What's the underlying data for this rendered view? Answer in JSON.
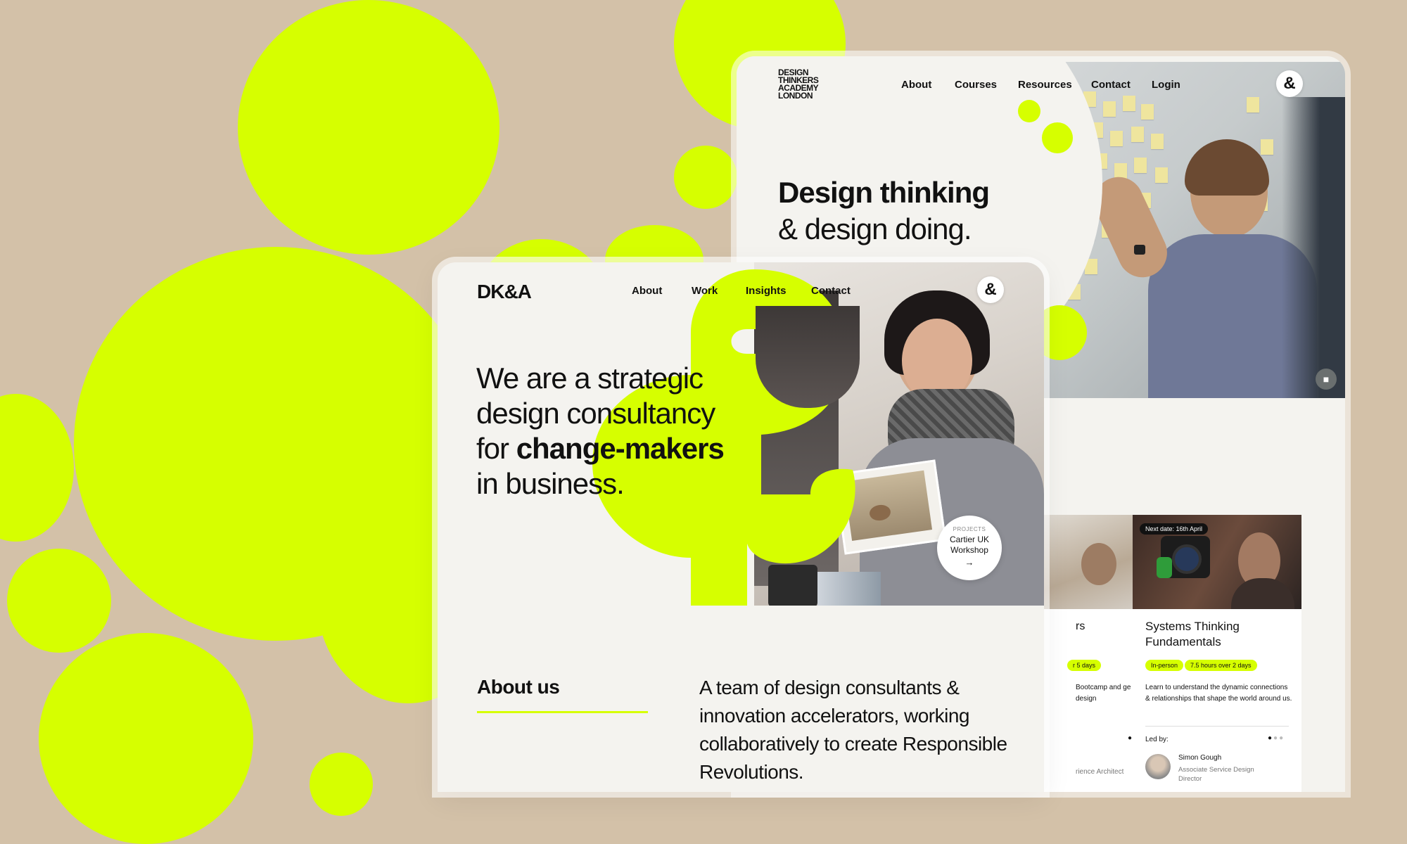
{
  "back_site": {
    "logo": "DESIGN THINKERS ACADEMY LONDON",
    "logo_lines": [
      "DESIGN",
      "THINKERS",
      "ACADEMY",
      "LONDON"
    ],
    "nav": [
      "About",
      "Courses",
      "Resources",
      "Contact",
      "Login"
    ],
    "logo_icon": "ampersand-icon",
    "hero_title_bold": "Design thinking",
    "hero_title_rest": "& design doing.",
    "chat_icon": "chat-icon",
    "course_cards": [
      {
        "title_fragment": "rs",
        "tag_fragment": "r 5 days",
        "desc_fragment": "Bootcamp and ge of the design",
        "leader_fragment": "rience Architect"
      },
      {
        "badge": "Next date: 16th April",
        "title": "Systems Thinking Fundamentals",
        "tags": [
          "In-person",
          "7.5 hours over 2 days"
        ],
        "description": "Learn to understand the dynamic connections & relationships that shape the world around us.",
        "led_by_label": "Led by:",
        "leader_name": "Simon Gough",
        "leader_role": "Associate Service Design Director"
      }
    ]
  },
  "front_site": {
    "logo": "DK&A",
    "nav": [
      "About",
      "Work",
      "Insights",
      "Contact"
    ],
    "logo_icon": "ampersand-icon",
    "hero_line1": "We are a strategic",
    "hero_line2": "design consultancy",
    "hero_line3_pre": "for ",
    "hero_line3_bold": "change-makers",
    "hero_line4": "in business.",
    "project_badge": {
      "label": "PROJECTS",
      "title": "Cartier UK Workshop",
      "arrow": "→"
    },
    "about_heading": "About us",
    "about_text": "A team of design consultants & innovation accelerators, working collaboratively to create Responsible Revolutions."
  },
  "colors": {
    "accent": "#d6ff00",
    "background": "#d3c1a8",
    "page": "#f4f3ef",
    "text": "#111111"
  }
}
